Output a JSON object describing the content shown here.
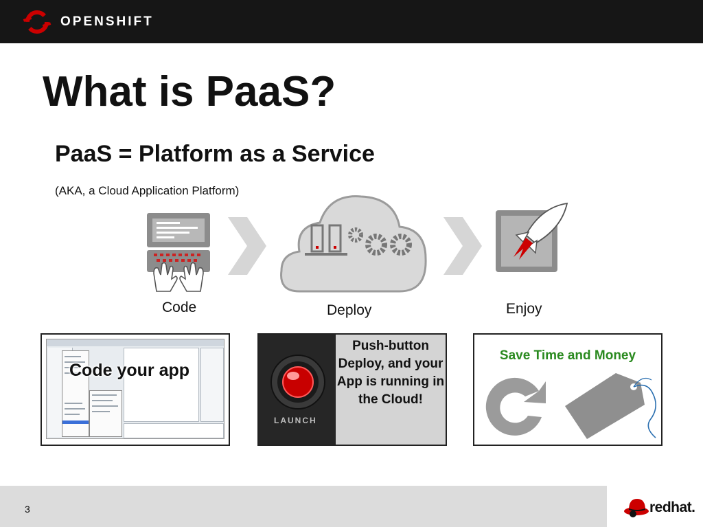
{
  "header": {
    "brand": "OPENSHIFT",
    "logo_icon": "openshift-logo-icon"
  },
  "slide": {
    "title": "What is PaaS?",
    "subtitle": "PaaS = Platform as a Service",
    "aka": "(AKA, a Cloud Application Platform)"
  },
  "flow": {
    "steps": [
      {
        "label": "Code",
        "icon": "keyboard-code-icon"
      },
      {
        "label": "Deploy",
        "icon": "cloud-gears-icon"
      },
      {
        "label": "Enjoy",
        "icon": "rocket-icon"
      }
    ],
    "arrow_icon": "chevron-right-arrow-icon"
  },
  "panels": {
    "code": {
      "caption": "Code your app"
    },
    "launch": {
      "text": "Push-button Deploy, and your App is running in the Cloud!",
      "button_label": "LAUNCH"
    },
    "save": {
      "text": "Save Time and Money",
      "icons": [
        "clock-arrow-icon",
        "price-tag-icon"
      ]
    }
  },
  "footer": {
    "page_number": "3",
    "brand": "redhat."
  },
  "colors": {
    "accent_red": "#cc0000",
    "save_green": "#2a8a1f",
    "header_bg": "#161616",
    "icon_gray": "#8c8c8c"
  }
}
